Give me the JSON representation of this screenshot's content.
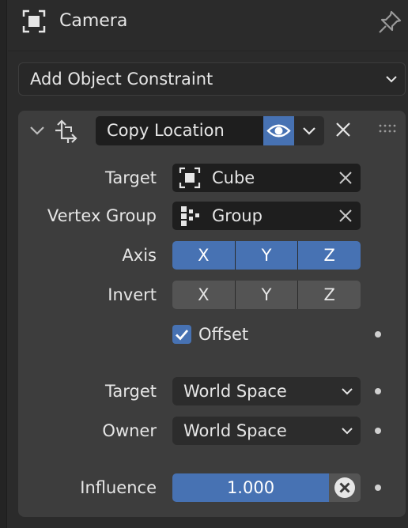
{
  "header": {
    "title": "Camera",
    "icon": "camera-object-icon",
    "pin_icon": "pin-icon"
  },
  "add_constraint": {
    "label": "Add Object Constraint"
  },
  "constraint": {
    "name": "Copy Location",
    "icon": "move-arrows-icon",
    "accent": "#4772b3",
    "fields": {
      "target": {
        "label": "Target",
        "value": "Cube",
        "icon": "object-icon"
      },
      "vertex_group": {
        "label": "Vertex Group",
        "value": "Group",
        "icon": "vertex-group-icon"
      },
      "axis": {
        "label": "Axis",
        "options": [
          "X",
          "Y",
          "Z"
        ],
        "selected": [
          true,
          true,
          true
        ]
      },
      "invert": {
        "label": "Invert",
        "options": [
          "X",
          "Y",
          "Z"
        ],
        "selected": [
          false,
          false,
          false
        ]
      },
      "offset": {
        "label": "Offset",
        "checked": true
      },
      "target_space": {
        "label": "Target",
        "value": "World Space"
      },
      "owner_space": {
        "label": "Owner",
        "value": "World Space"
      },
      "influence": {
        "label": "Influence",
        "value": "1.000"
      }
    }
  }
}
